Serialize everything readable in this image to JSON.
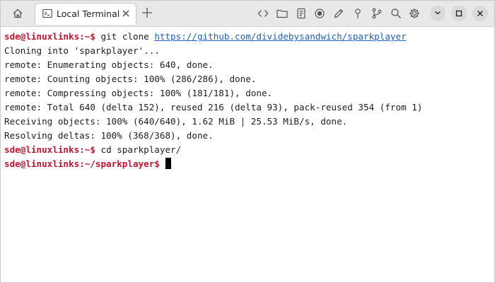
{
  "window": {
    "tab_title": "Local Terminal"
  },
  "toolbar": {
    "left_icons": [
      "home-icon"
    ],
    "tab_icons": [
      "terminal-icon",
      "close-icon"
    ],
    "right_icons": [
      "code-icon",
      "folder-icon",
      "document-icon",
      "record-icon",
      "pencil-icon",
      "pin-icon",
      "branch-icon",
      "search-icon",
      "gear-icon"
    ],
    "window_controls": [
      "minimize-icon",
      "maximize-icon",
      "close-window-icon"
    ]
  },
  "terminal": {
    "prompt1": "sde@linuxlinks:~$",
    "cmd1_text": " git clone ",
    "cmd1_url": "https://github.com/dividebysandwich/sparkplayer",
    "output": [
      "Cloning into 'sparkplayer'...",
      "remote: Enumerating objects: 640, done.",
      "remote: Counting objects: 100% (286/286), done.",
      "remote: Compressing objects: 100% (181/181), done.",
      "remote: Total 640 (delta 152), reused 216 (delta 93), pack-reused 354 (from 1)",
      "Receiving objects: 100% (640/640), 1.62 MiB | 25.53 MiB/s, done.",
      "Resolving deltas: 100% (368/368), done."
    ],
    "prompt2": "sde@linuxlinks:~$",
    "cmd2": " cd sparkplayer/",
    "prompt3": "sde@linuxlinks:~/sparkplayer$",
    "cmd3": " "
  },
  "colors": {
    "prompt": "#c8102e",
    "link": "#1f5fbf",
    "text": "#1e1e1e",
    "titlebar": "#e8e8e8"
  }
}
